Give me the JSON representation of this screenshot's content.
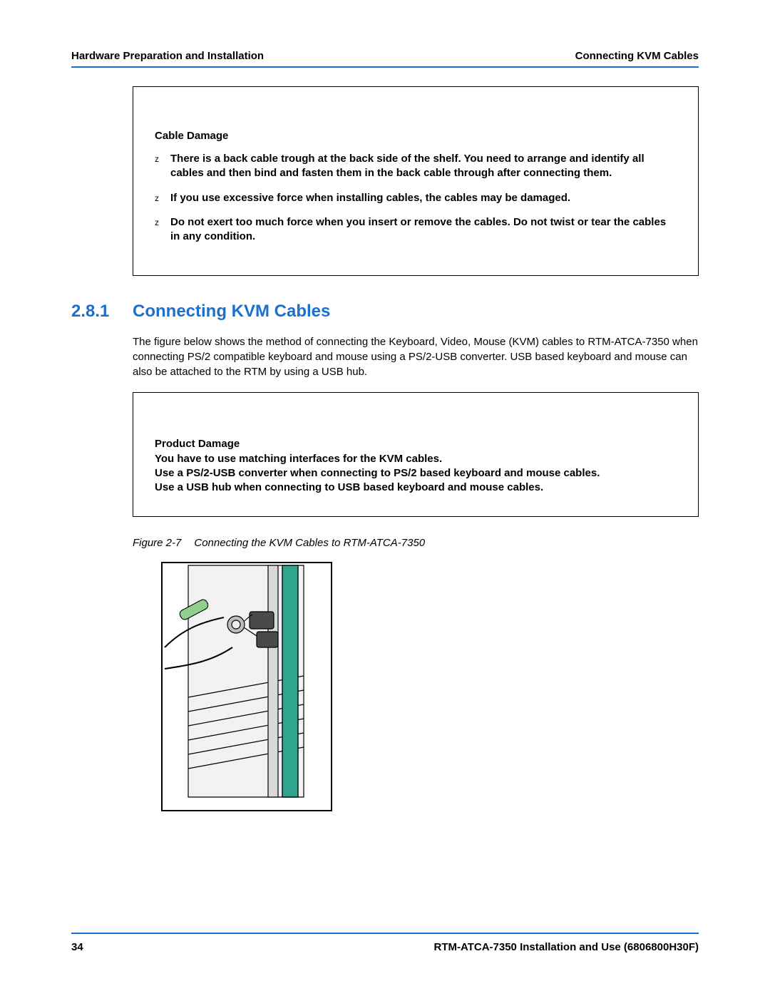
{
  "header": {
    "left": "Hardware Preparation and Installation",
    "right": "Connecting KVM Cables"
  },
  "notice1": {
    "title": "Cable Damage",
    "items": [
      "There is a back cable trough at the back side of the shelf. You need to arrange and identify all cables and then bind and fasten them in the back cable through after connecting them.",
      "If you use excessive force when installing cables, the cables may be damaged.",
      "Do not exert too much force when you insert or remove the cables. Do not twist or tear the cables in any condition."
    ]
  },
  "section": {
    "number": "2.8.1",
    "title": "Connecting KVM Cables"
  },
  "paragraph": "The figure below shows the method of connecting the Keyboard, Video, Mouse (KVM) cables to RTM-ATCA-7350 when connecting PS/2 compatible keyboard and mouse using a PS/2-USB converter. USB based keyboard and mouse can also be attached to the RTM by using a USB hub.",
  "notice2": {
    "title": "Product Damage",
    "lines": [
      "You have to use matching interfaces for the KVM cables.",
      "Use a PS/2-USB converter when connecting to PS/2 based keyboard and mouse cables.",
      "Use a USB hub when connecting to USB based keyboard and mouse cables."
    ]
  },
  "figure": {
    "label": "Figure 2-7",
    "caption": "Connecting the KVM Cables to RTM-ATCA-7350"
  },
  "footer": {
    "page": "34",
    "doc": "RTM-ATCA-7350 Installation and Use (6806800H30F)"
  }
}
